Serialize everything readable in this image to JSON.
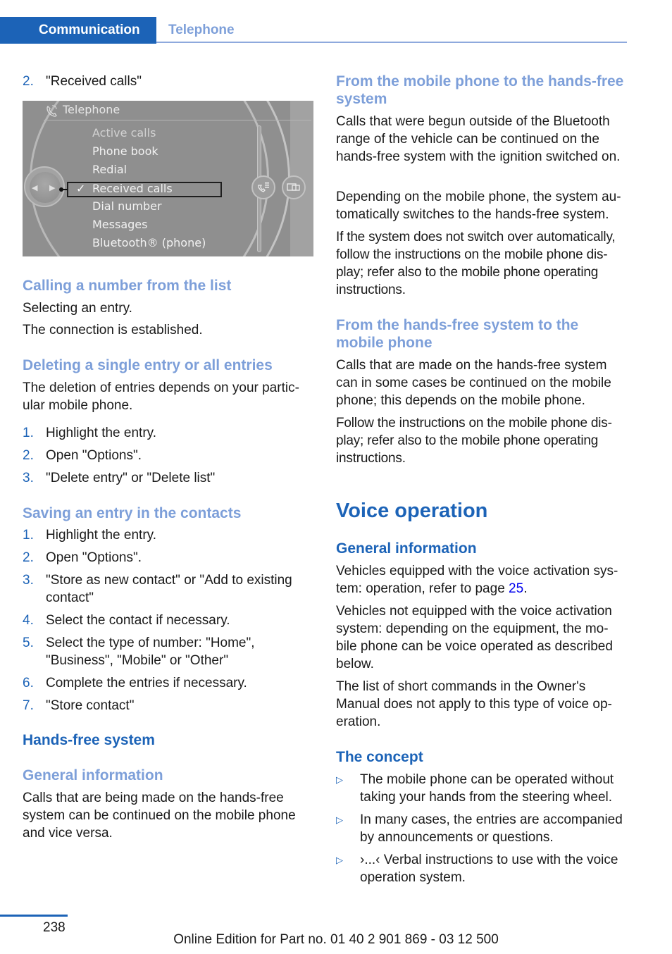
{
  "header": {
    "section": "Communication",
    "subsection": "Telephone"
  },
  "left": {
    "step2": {
      "num": "2.",
      "text": "\"Received calls\""
    },
    "screen": {
      "title": "Telephone",
      "title_icon": "telephone-icon",
      "menu_items": [
        {
          "label": "Active calls",
          "dim": true
        },
        {
          "label": "Phone book"
        },
        {
          "label": "Redial"
        },
        {
          "label": "Received calls",
          "selected": true
        },
        {
          "label": "Dial number"
        },
        {
          "label": "Messages"
        },
        {
          "label": "Bluetooth® (phone)"
        }
      ],
      "check_glyph": "✓",
      "knob_left": "◀",
      "knob_right": "▶",
      "right_icons": [
        "voice-phone-icon",
        "split-screen-icon"
      ]
    },
    "calling": {
      "heading": "Calling a number from the list",
      "p1": "Selecting an entry.",
      "p2": "The connection is established."
    },
    "deleting": {
      "heading": "Deleting a single entry or all entries",
      "p1": "The deletion of entries depends on your partic-ular mobile phone.",
      "steps": [
        {
          "num": "1.",
          "text": "Highlight the entry."
        },
        {
          "num": "2.",
          "text": "Open \"Options\"."
        },
        {
          "num": "3.",
          "text": "\"Delete entry\" or \"Delete list\""
        }
      ]
    },
    "saving": {
      "heading": "Saving an entry in the contacts",
      "steps": [
        {
          "num": "1.",
          "text": "Highlight the entry."
        },
        {
          "num": "2.",
          "text": "Open \"Options\"."
        },
        {
          "num": "3.",
          "text": "\"Store as new contact\" or \"Add to existing contact\""
        },
        {
          "num": "4.",
          "text": "Select the contact if necessary."
        },
        {
          "num": "5.",
          "text": "Select the type of number: \"Home\", \"Business\", \"Mobile\" or \"Other\""
        },
        {
          "num": "6.",
          "text": "Complete the entries if necessary."
        },
        {
          "num": "7.",
          "text": "\"Store contact\""
        }
      ]
    },
    "handsfree": {
      "heading": "Hands-free system",
      "subheading": "General information",
      "p1": "Calls that are being made on the hands-free system can be continued on the mobile phone and vice versa."
    }
  },
  "right": {
    "mobile_to_hf": {
      "heading": "From the mobile phone to the hands-free system",
      "p1": "Calls that were begun outside of the Bluetooth range of the vehicle can be continued on the hands-free system with the ignition switched on.",
      "p2": "Depending on the mobile phone, the system au-tomatically switches to the hands-free system.",
      "p3": "If the system does not switch over automatically, follow the instructions on the mobile phone dis-play; refer also to the mobile phone operating instructions."
    },
    "hf_to_mobile": {
      "heading": "From the hands-free system to the mobile phone",
      "p1": "Calls that are made on the hands-free system can in some cases be continued on the mobile phone; this depends on the mobile phone.",
      "p2": "Follow the instructions on the mobile phone dis-play; refer also to the mobile phone operating instructions."
    },
    "voice": {
      "heading": "Voice operation",
      "general_heading": "General information",
      "p1_prefix": "Vehicles equipped with the voice activation sys-tem: operation, refer to page ",
      "p1_link": "25",
      "p1_suffix": ".",
      "p2": "Vehicles not equipped with the voice activation system: depending on the equipment, the mo-bile phone can be voice operated as described below.",
      "p3": "The list of short commands in the Owner's Manual does not apply to this type of voice op-eration.",
      "concept_heading": "The concept",
      "bullet_glyph": "▷",
      "bullets": [
        "The mobile phone can be operated without taking your hands from the steering wheel.",
        "In many cases, the entries are accompanied by announcements or questions.",
        "›...‹ Verbal instructions to use with the voice operation system."
      ]
    }
  },
  "footer": {
    "page_number": "238",
    "edition": "Online Edition for Part no. 01 40 2 901 869 - 03 12 500"
  }
}
